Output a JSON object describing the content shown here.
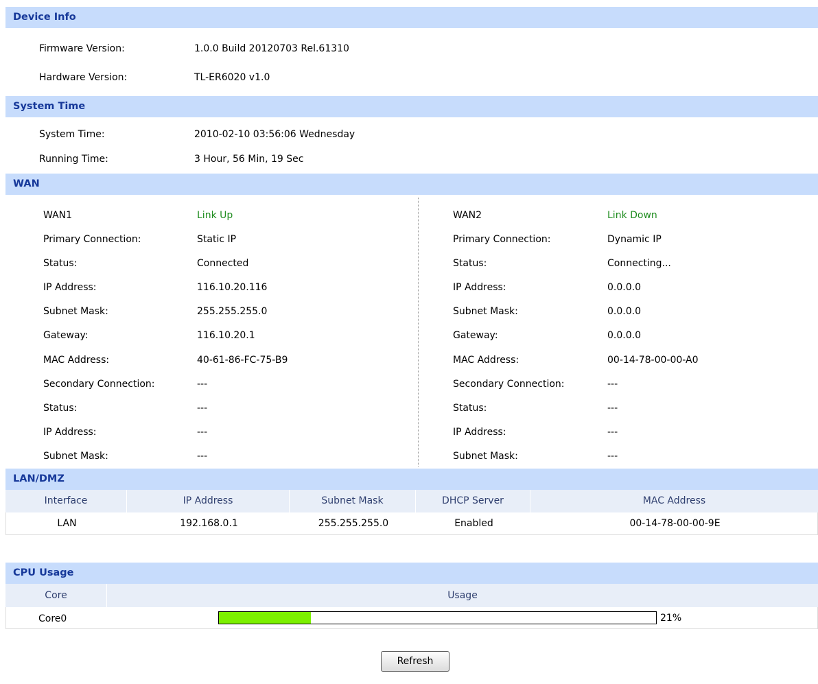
{
  "device_info": {
    "title": "Device Info",
    "firmware_label": "Firmware Version:",
    "firmware_value": "1.0.0 Build 20120703 Rel.61310",
    "hardware_label": "Hardware Version:",
    "hardware_value": "TL-ER6020 v1.0"
  },
  "system_time": {
    "title": "System Time",
    "time_label": "System Time:",
    "time_value": "2010-02-10 03:56:06 Wednesday",
    "running_label": "Running Time:",
    "running_value": "3 Hour, 56 Min, 19 Sec"
  },
  "wan": {
    "title": "WAN",
    "wan1": {
      "name": "WAN1",
      "link": "Link Up",
      "rows": [
        {
          "label": "Primary Connection:",
          "value": "Static IP"
        },
        {
          "label": "Status:",
          "value": "Connected"
        },
        {
          "label": "IP Address:",
          "value": "116.10.20.116"
        },
        {
          "label": "Subnet Mask:",
          "value": "255.255.255.0"
        },
        {
          "label": "Gateway:",
          "value": "116.10.20.1"
        },
        {
          "label": "MAC Address:",
          "value": "40-61-86-FC-75-B9"
        },
        {
          "label": "Secondary Connection:",
          "value": "---"
        },
        {
          "label": "Status:",
          "value": "---"
        },
        {
          "label": "IP Address:",
          "value": "---"
        },
        {
          "label": "Subnet Mask:",
          "value": "---"
        }
      ]
    },
    "wan2": {
      "name": "WAN2",
      "link": "Link Down",
      "rows": [
        {
          "label": "Primary Connection:",
          "value": "Dynamic IP"
        },
        {
          "label": "Status:",
          "value": "Connecting..."
        },
        {
          "label": "IP Address:",
          "value": "0.0.0.0"
        },
        {
          "label": "Subnet Mask:",
          "value": "0.0.0.0"
        },
        {
          "label": "Gateway:",
          "value": "0.0.0.0"
        },
        {
          "label": "MAC Address:",
          "value": "00-14-78-00-00-A0"
        },
        {
          "label": "Secondary Connection:",
          "value": "---"
        },
        {
          "label": "Status:",
          "value": "---"
        },
        {
          "label": "IP Address:",
          "value": "---"
        },
        {
          "label": "Subnet Mask:",
          "value": "---"
        }
      ]
    }
  },
  "lan": {
    "title": "LAN/DMZ",
    "headers": [
      "Interface",
      "IP Address",
      "Subnet Mask",
      "DHCP Server",
      "MAC Address"
    ],
    "row": [
      "LAN",
      "192.168.0.1",
      "255.255.255.0",
      "Enabled",
      "00-14-78-00-00-9E"
    ]
  },
  "cpu": {
    "title": "CPU Usage",
    "headers": [
      "Core",
      "Usage"
    ],
    "core_name": "Core0",
    "usage_percent": 21,
    "usage_label": "21%"
  },
  "refresh_label": "Refresh",
  "colors": {
    "section_bg": "#c7dcfc",
    "section_text": "#17399a",
    "link_up": "#1e8c1e",
    "bar_fill": "#7cf000"
  }
}
